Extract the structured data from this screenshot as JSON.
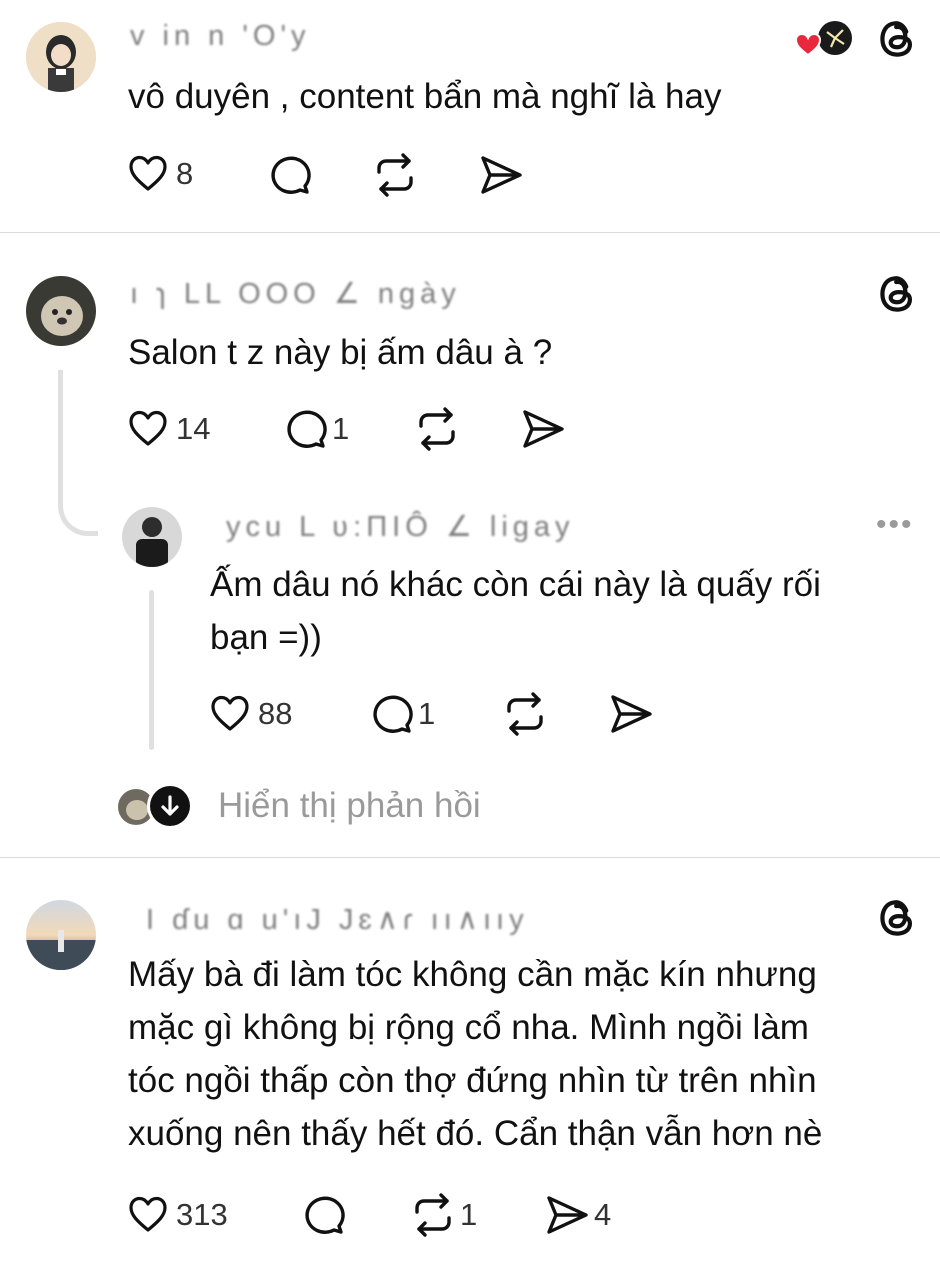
{
  "posts": [
    {
      "username": "v in n 'O'y",
      "text_lines": [
        "vô duyên , content bẩn mà nghĩ là hay"
      ],
      "likes": "8",
      "replies": "",
      "reposts": "",
      "shares": ""
    },
    {
      "username": "ı ɿ LL OOO ∠ ngày",
      "text_lines": [
        "Salon t z này bị ấm dâu à ?"
      ],
      "likes": "14",
      "replies": "1",
      "reposts": "",
      "shares": ""
    },
    {
      "username": "ycu L ʋ:ΠIÔ ∠ ligay",
      "text_lines": [
        "Ấm dâu nó khác còn cái này là quấy rối",
        "bạn =))"
      ],
      "likes": "88",
      "replies": "1",
      "reposts": "",
      "shares": ""
    },
    {
      "username": "I ɗu ɑ u'ıJ Jɛ∧ɾ ıı∧ııy",
      "text_lines": [
        "Mấy bà đi làm tóc không cần mặc kín nhưng",
        "mặc gì không bị rộng cổ nha. Mình ngồi làm",
        "tóc ngồi thấp còn thợ đứng nhìn từ trên nhìn",
        "xuống nên thấy hết đó. Cẩn thận vẫn hơn nè"
      ],
      "likes": "313",
      "replies": "",
      "reposts": "1",
      "shares": "4"
    }
  ],
  "show_replies_label": "Hiển thị phản hồi",
  "more_label": "•••",
  "colors": {
    "like_heart": "#e8283c",
    "muted_text": "#9a9a9a",
    "divider": "#dbdbdb"
  },
  "icons": [
    "heart-icon",
    "comment-icon",
    "repost-icon",
    "share-icon",
    "threads-logo-icon",
    "more-icon",
    "arrow-down-icon"
  ]
}
